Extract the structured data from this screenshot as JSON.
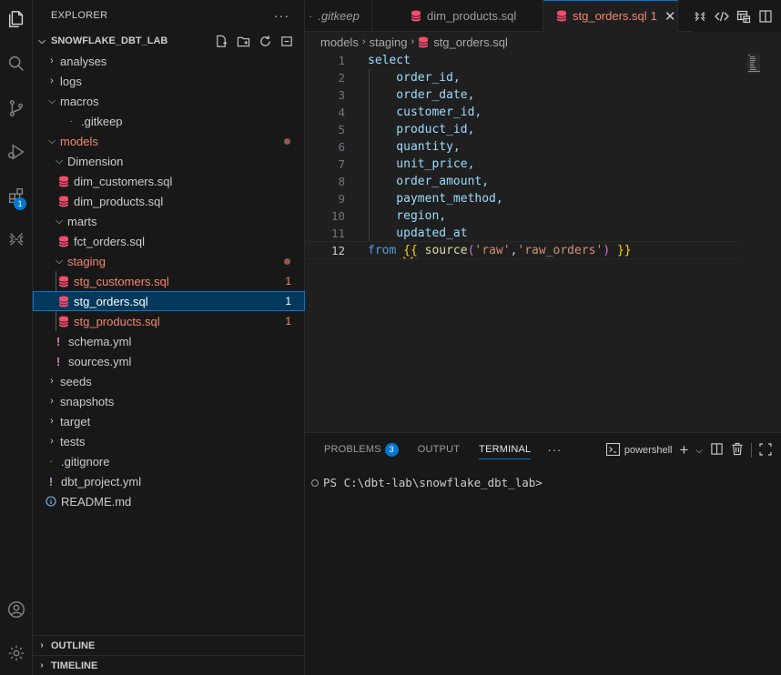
{
  "activity_bar": {
    "items": [
      {
        "name": "explorer",
        "icon": "files-icon"
      },
      {
        "name": "search",
        "icon": "search-icon"
      },
      {
        "name": "source-control",
        "icon": "source-control-icon"
      },
      {
        "name": "run-debug",
        "icon": "run-debug-icon"
      },
      {
        "name": "extensions",
        "icon": "extensions-icon",
        "badge": "1"
      },
      {
        "name": "snowflake",
        "icon": "snowflake-icon"
      }
    ],
    "bottom": [
      {
        "name": "accounts",
        "icon": "account-icon"
      },
      {
        "name": "manage",
        "icon": "gear-icon"
      }
    ]
  },
  "sidebar": {
    "title": "EXPLORER",
    "more": "···",
    "project": "SNOWFLAKE_DBT_LAB",
    "tree": [
      {
        "label": "analyses"
      },
      {
        "label": "logs"
      },
      {
        "label": "macros"
      },
      {
        "label": ".gitkeep"
      },
      {
        "label": "models"
      },
      {
        "label": "Dimension"
      },
      {
        "label": "dim_customers.sql"
      },
      {
        "label": "dim_products.sql"
      },
      {
        "label": "marts"
      },
      {
        "label": "fct_orders.sql"
      },
      {
        "label": "staging"
      },
      {
        "label": "stg_customers.sql",
        "problems": "1"
      },
      {
        "label": "stg_orders.sql",
        "problems": "1"
      },
      {
        "label": "stg_products.sql",
        "problems": "1"
      },
      {
        "label": "schema.yml"
      },
      {
        "label": "sources.yml"
      },
      {
        "label": "seeds"
      },
      {
        "label": "snapshots"
      },
      {
        "label": "target"
      },
      {
        "label": "tests"
      },
      {
        "label": ".gitignore"
      },
      {
        "label": "dbt_project.yml"
      },
      {
        "label": "README.md"
      }
    ],
    "outline": "OUTLINE",
    "timeline": "TIMELINE"
  },
  "tabs": [
    {
      "label": ".gitkeep"
    },
    {
      "label": "dim_products.sql"
    },
    {
      "label": "stg_orders.sql",
      "problems": "1",
      "close": "✕"
    }
  ],
  "breadcrumb": [
    "models",
    "staging",
    "stg_orders.sql"
  ],
  "editor": {
    "line_numbers": [
      "1",
      "2",
      "3",
      "4",
      "5",
      "6",
      "7",
      "8",
      "9",
      "10",
      "11",
      "12"
    ],
    "lines": [
      "select",
      "    order_id,",
      "    order_date,",
      "    customer_id,",
      "    product_id,",
      "    quantity,",
      "    unit_price,",
      "    order_amount,",
      "    payment_method,",
      "    region,",
      "    updated_at"
    ],
    "last_line": {
      "kw": "from",
      "open": "{{",
      "fn": "source",
      "paren_open": "(",
      "arg1": "'raw'",
      "comma": ",",
      "arg2": "'raw_orders'",
      "paren_close": ")",
      "close": "}}"
    }
  },
  "panel": {
    "tabs": {
      "problems": "PROBLEMS",
      "problems_count": "3",
      "output": "OUTPUT",
      "terminal": "TERMINAL"
    },
    "more": "···",
    "shell": "powershell",
    "prompt": "PS C:\\dbt-lab\\snowflake_dbt_lab>"
  }
}
